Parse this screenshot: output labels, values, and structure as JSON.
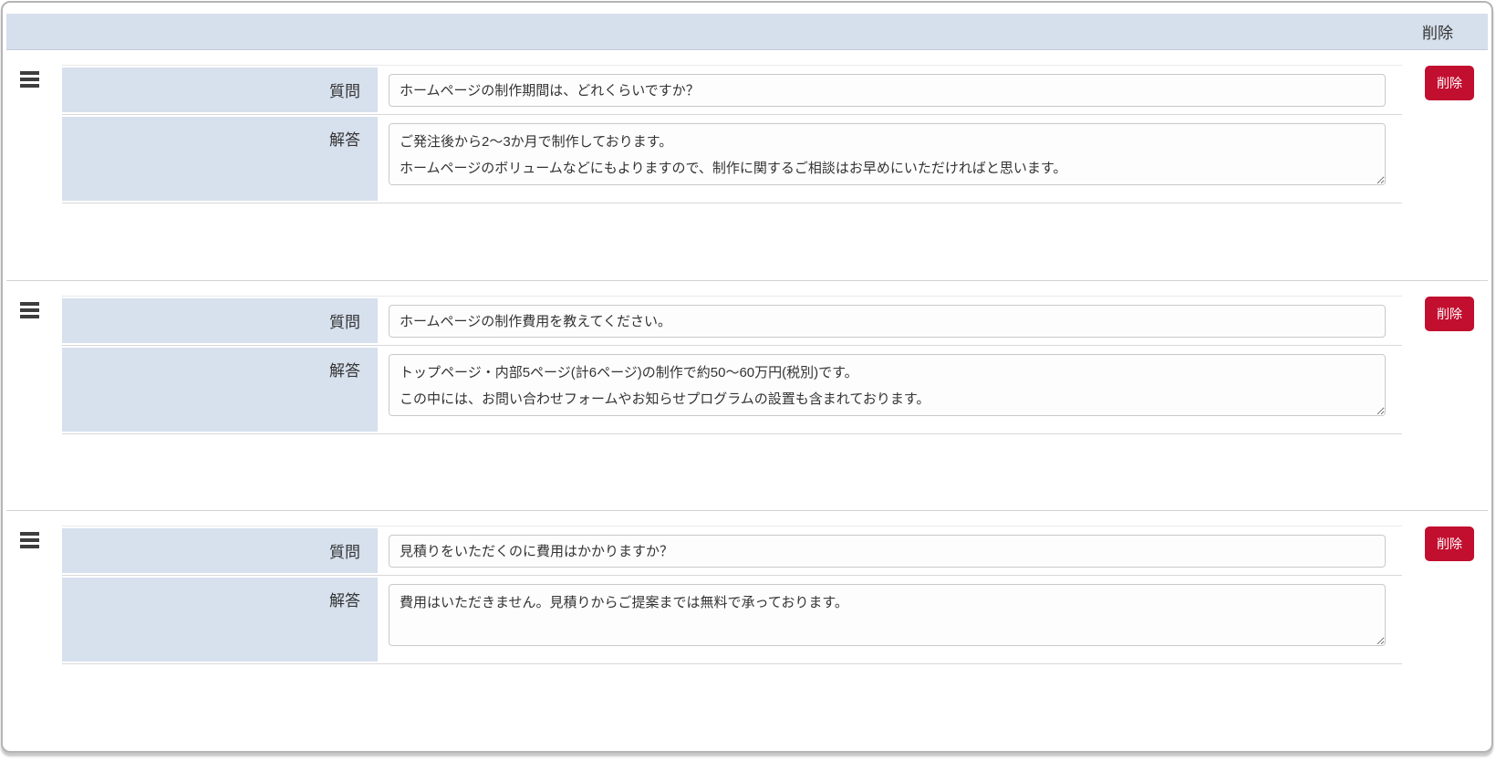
{
  "header": {
    "delete_column_label": "削除"
  },
  "labels": {
    "question": "質問",
    "answer": "解答"
  },
  "buttons": {
    "delete_label": "削除"
  },
  "colors": {
    "accent_blue": "#d6dfec",
    "delete_red": "#c20e2f",
    "border_gray": "#b5b5b5"
  },
  "faqs": [
    {
      "question": "ホームページの制作期間は、どれくらいですか？",
      "answer": "ご発注後から2〜3か月で制作しております。\nホームページのボリュームなどにもよりますので、制作に関するご相談はお早めにいただければと思います。"
    },
    {
      "question": "ホームページの制作費用を教えてください。",
      "answer": "トップページ・内部5ページ(計6ページ)の制作で約50〜60万円(税別)です。\nこの中には、お問い合わせフォームやお知らせプログラムの設置も含まれております。"
    },
    {
      "question": "見積りをいただくのに費用はかかりますか？",
      "answer": "費用はいただきません。見積りからご提案までは無料で承っております。"
    }
  ]
}
